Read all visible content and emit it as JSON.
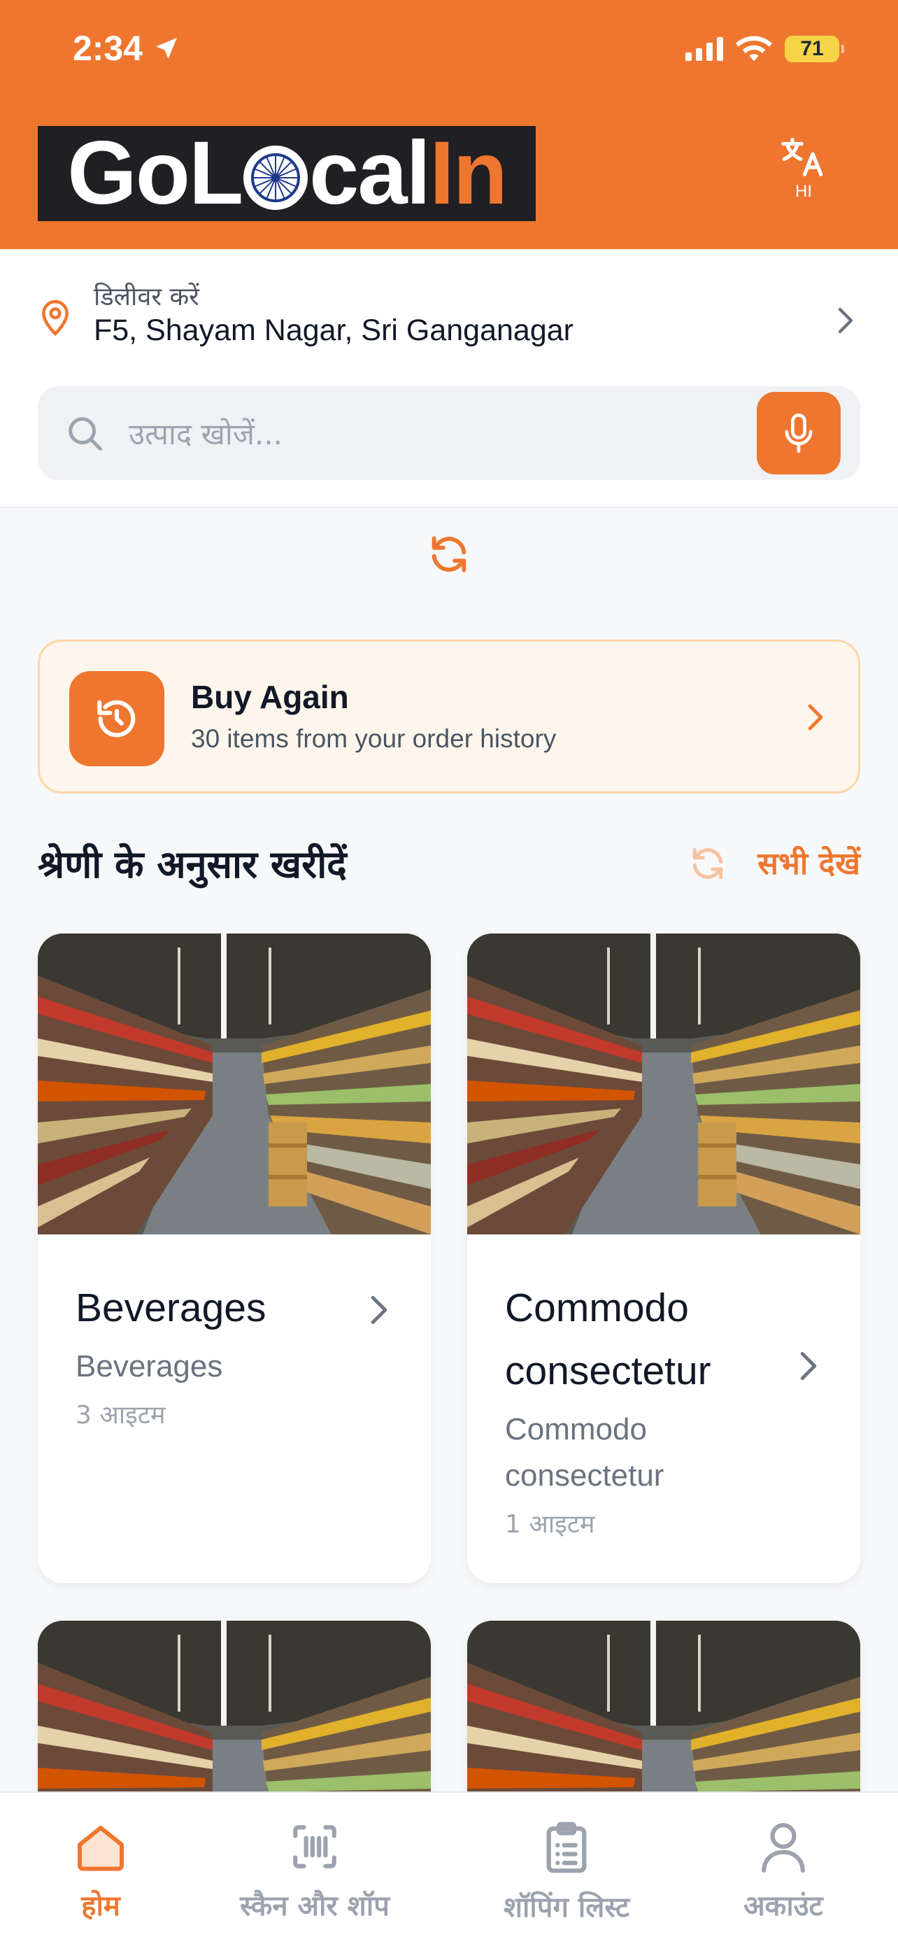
{
  "status_bar": {
    "time": "2:34",
    "battery": "71"
  },
  "header": {
    "logo_parts": {
      "part1": "GoL",
      "part2": "cal",
      "part3": "In"
    },
    "language_code": "HI"
  },
  "delivery": {
    "label": "डिलीवर करें",
    "address": "F5, Shayam Nagar, Sri Ganganagar"
  },
  "search": {
    "placeholder": "उत्पाद खोजें..."
  },
  "buy_again": {
    "title": "Buy Again",
    "subtitle": "30 items from your order history"
  },
  "categories_section": {
    "title": "श्रेणी के अनुसार खरीदें",
    "see_all": "सभी देखें"
  },
  "categories": [
    {
      "name": "Beverages",
      "description": "Beverages",
      "count": "3 आइटम"
    },
    {
      "name": "Commodo consectetur",
      "description": "Commodo consectetur",
      "count": "1 आइटम"
    }
  ],
  "bottom_nav": [
    {
      "label": "होम",
      "icon": "home-icon",
      "active": true
    },
    {
      "label": "स्कैन और शॉप",
      "icon": "barcode-scan-icon",
      "active": false
    },
    {
      "label": "शॉपिंग लिस्ट",
      "icon": "clipboard-list-icon",
      "active": false
    },
    {
      "label": "अकाउंट",
      "icon": "user-icon",
      "active": false
    }
  ],
  "colors": {
    "brand": "#ef762f",
    "logo_bg": "#1f1f24",
    "buy_again_bg": "#fef6ec"
  }
}
